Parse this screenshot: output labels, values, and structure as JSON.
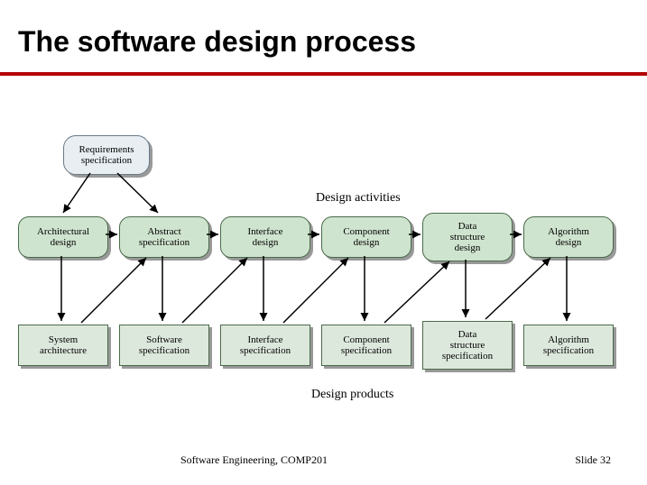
{
  "title": "The software design process",
  "labels": {
    "activities": "Design activities",
    "products": "Design products"
  },
  "input": {
    "label": "Requirements\nspecification"
  },
  "activities": [
    {
      "id": "arch",
      "label": "Architectural\ndesign"
    },
    {
      "id": "abs",
      "label": "Abstract\nspecification"
    },
    {
      "id": "if",
      "label": "Interface\ndesign"
    },
    {
      "id": "comp",
      "label": "Component\ndesign"
    },
    {
      "id": "ds",
      "label": "Data\nstructure\ndesign"
    },
    {
      "id": "algo",
      "label": "Algorithm\ndesign"
    }
  ],
  "products": [
    {
      "id": "sysarch",
      "label": "System\narchitecture"
    },
    {
      "id": "swspec",
      "label": "Software\nspecification"
    },
    {
      "id": "ifspec",
      "label": "Interface\nspecification"
    },
    {
      "id": "compspec",
      "label": "Component\nspecification"
    },
    {
      "id": "dsspec",
      "label": "Data\nstructure\nspecification"
    },
    {
      "id": "algospec",
      "label": "Algorithm\nspecification"
    }
  ],
  "footer": {
    "left": "Software Engineering, COMP201",
    "right_prefix": "Slide ",
    "slide_number": "32"
  },
  "diagram_semantics": {
    "note": "Arrows: input→arch and input→abs; each activity points to the next (arch→abs→if→comp→ds→algo); each activity also points down to its corresponding product; each product (except last) points diagonally up-right to the next activity."
  }
}
